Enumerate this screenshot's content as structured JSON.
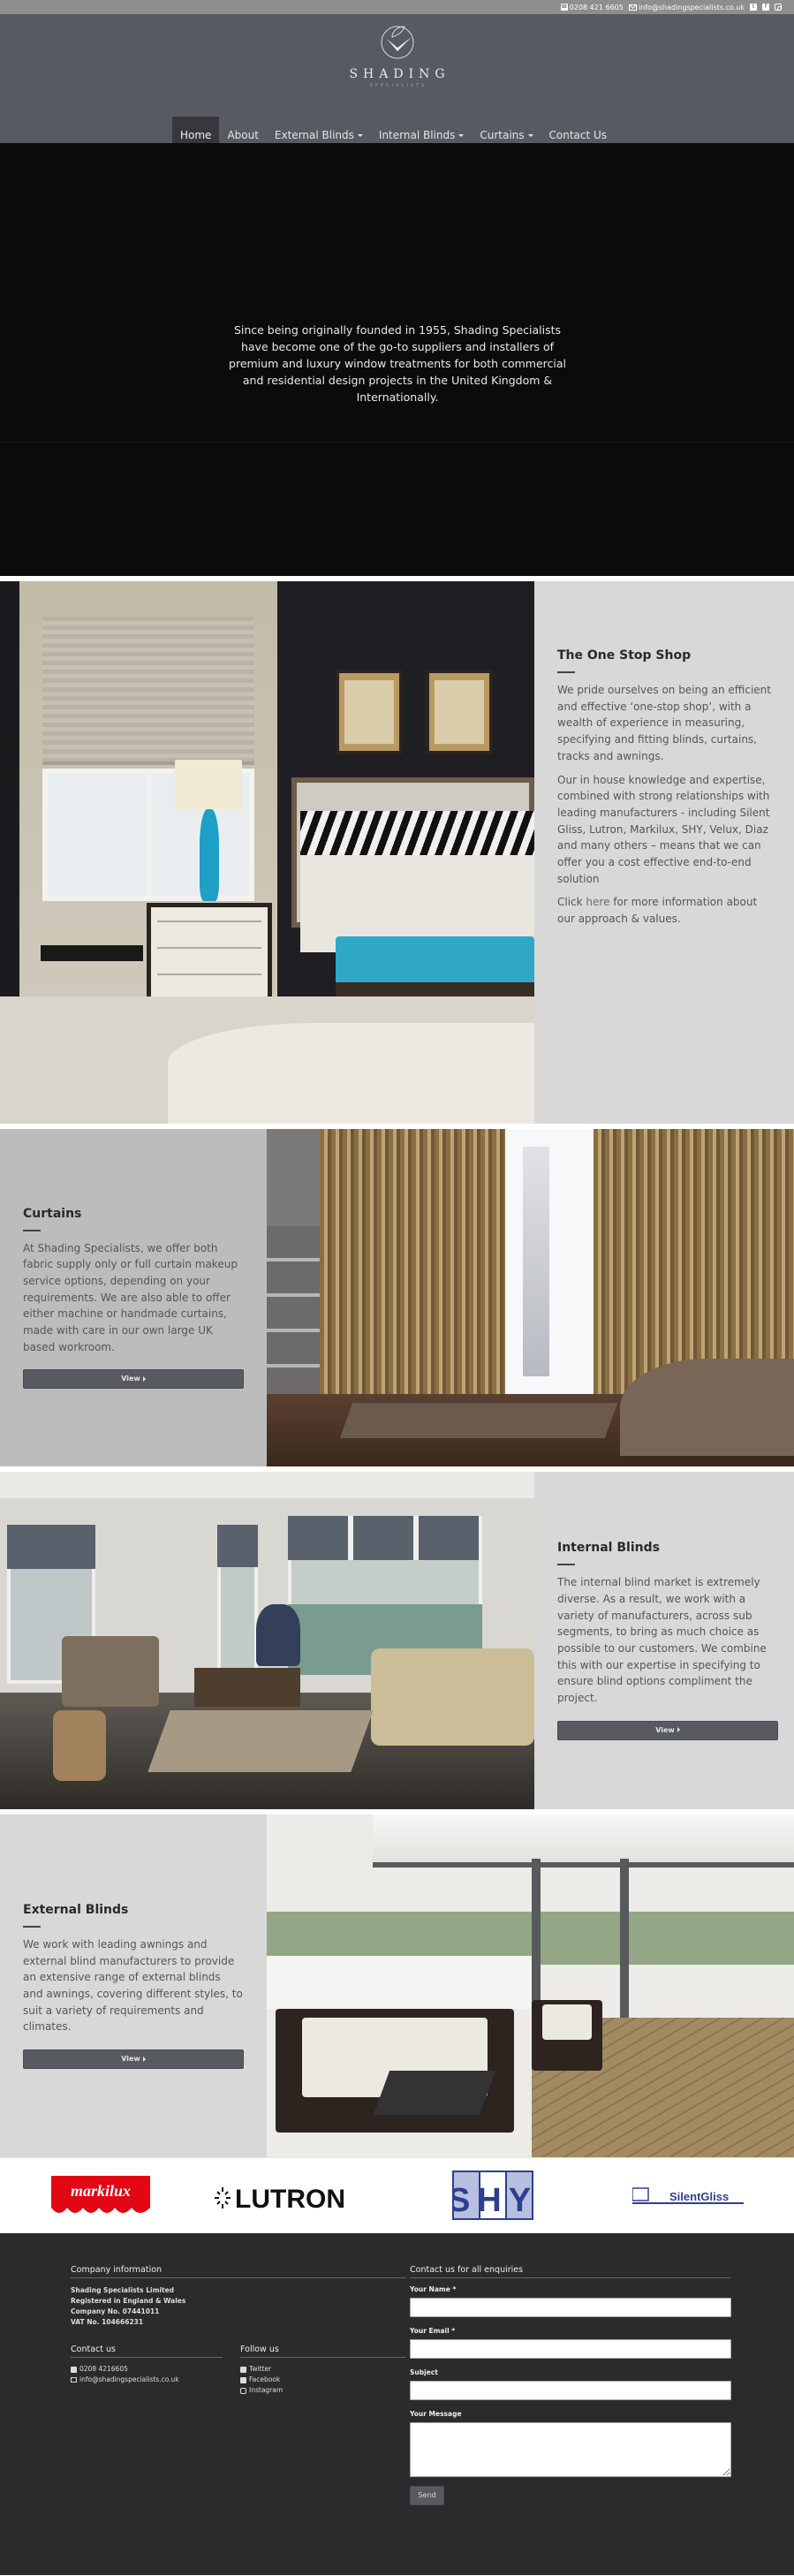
{
  "topbar": {
    "phone": "0208 421 6605",
    "email": "info@shadingspecialists.co.uk",
    "social": [
      "twitter-icon",
      "facebook-icon",
      "instagram-icon"
    ]
  },
  "header": {
    "logo_name": "SHADING",
    "logo_sub": "SPECIALISTS",
    "nav": [
      {
        "label": "Home",
        "active": true,
        "dropdown": false
      },
      {
        "label": "About",
        "active": false,
        "dropdown": false
      },
      {
        "label": "External Blinds",
        "active": false,
        "dropdown": true
      },
      {
        "label": "Internal Blinds",
        "active": false,
        "dropdown": true
      },
      {
        "label": "Curtains",
        "active": false,
        "dropdown": true
      },
      {
        "label": "Contact Us",
        "active": false,
        "dropdown": false
      }
    ]
  },
  "hero": {
    "text": "Since being originally founded in 1955, Shading Specialists have become one of the go-to suppliers and installers of premium and luxury window treatments for both commercial and residential design projects in the United Kingdom & Internationally."
  },
  "sections": {
    "one_stop": {
      "title": "The One Stop Shop",
      "p1": "We pride ourselves on being an efficient and effective ‘one-stop shop’, with a wealth of experience in measuring, specifying and fitting blinds, curtains, tracks and awnings.",
      "p2": "Our in house knowledge and expertise, combined with strong relationships with leading manufacturers - including Silent Gliss, Lutron, Markilux, SHY, Velux, Diaz and many others – means that we can offer you a cost effective end-to-end solution",
      "p3_before": "Click ",
      "p3_link": "here",
      "p3_after": " for more information about our approach & values."
    },
    "curtains": {
      "title": "Curtains",
      "text": "At Shading Specialists, we offer both fabric supply only or full curtain makeup service options, depending on your requirements. We are also able to offer either machine or handmade curtains, made with care in our own large UK based workroom.",
      "button": "View"
    },
    "internal": {
      "title": "Internal Blinds",
      "text": "The internal blind market is extremely diverse. As a result, we work with a variety of manufacturers, across sub segments, to bring as much choice as possible to our customers. We combine this with our expertise in specifying to ensure blind options compliment the project.",
      "button": "View"
    },
    "external": {
      "title": "External Blinds",
      "text": "We work with leading awnings and external blind manufacturers to provide an extensive range of external blinds and awnings, covering different styles, to suit a variety of requirements and climates.",
      "button": "View"
    }
  },
  "brands": [
    "markilux",
    "LUTRON",
    "SHY",
    "SilentGliss"
  ],
  "colors": {
    "header": "#575a61",
    "nav_active": "#36383d",
    "panel_light": "#d8d8d8",
    "panel_mid": "#bcbcbc",
    "footer": "#2a2b2d",
    "markilux_red": "#e30613",
    "shy_blue": "#2e3f8f"
  },
  "footer": {
    "company_heading": "Company information",
    "company_lines": [
      "Shading Specialists Limited",
      "Registered in England & Wales",
      "Company No. 07441011",
      "VAT No. 104666231"
    ],
    "contact_heading": "Contact us",
    "contact_phone": "0208 4216605",
    "contact_email": "info@shadingspecialists.co.uk",
    "follow_heading": "Follow us",
    "follow_links": [
      "Twitter",
      "Facebook",
      "Instagram"
    ],
    "form": {
      "heading": "Contact us for all enquiries",
      "name_label": "Your Name *",
      "email_label": "Your Email *",
      "subject_label": "Subject",
      "message_label": "Your Message",
      "name_value": "",
      "email_value": "",
      "subject_value": "",
      "message_value": "",
      "send": "Send"
    }
  }
}
